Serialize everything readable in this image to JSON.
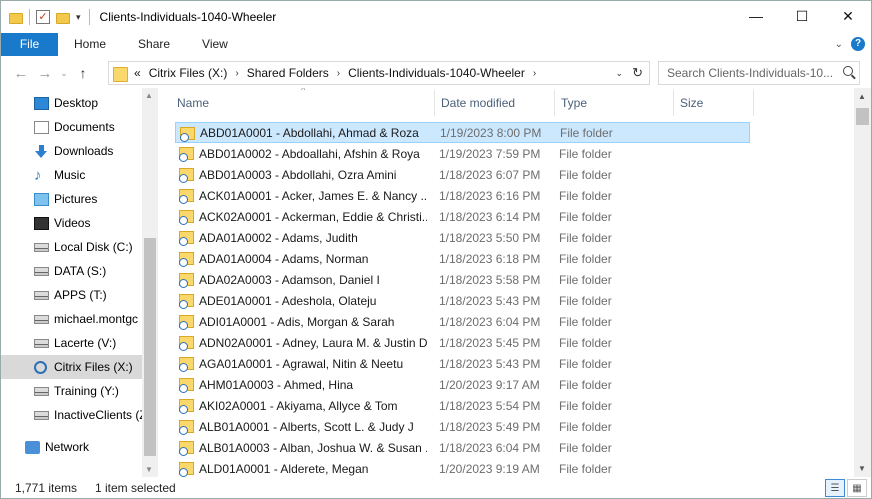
{
  "window": {
    "title": "Clients-Individuals-1040-Wheeler",
    "minimize": "—",
    "maximize": "☐",
    "close": "✕"
  },
  "ribbon": {
    "tabs": [
      "File",
      "Home",
      "Share",
      "View"
    ]
  },
  "address": {
    "overflow": "«",
    "crumbs": [
      "Citrix Files (X:)",
      "Shared Folders",
      "Clients-Individuals-1040-Wheeler"
    ]
  },
  "search": {
    "placeholder": "Search Clients-Individuals-10..."
  },
  "nav": {
    "items": [
      {
        "label": "Desktop",
        "icon": "desktop-icon"
      },
      {
        "label": "Documents",
        "icon": "documents-icon"
      },
      {
        "label": "Downloads",
        "icon": "downloads-icon"
      },
      {
        "label": "Music",
        "icon": "music-icon"
      },
      {
        "label": "Pictures",
        "icon": "pictures-icon"
      },
      {
        "label": "Videos",
        "icon": "videos-icon"
      },
      {
        "label": "Local Disk (C:)",
        "icon": "drive-icon"
      },
      {
        "label": "DATA (S:)",
        "icon": "network-drive-icon"
      },
      {
        "label": "APPS (T:)",
        "icon": "network-drive-icon"
      },
      {
        "label": "michael.montgc",
        "icon": "network-drive-icon"
      },
      {
        "label": "Lacerte (V:)",
        "icon": "network-drive-icon"
      },
      {
        "label": "Citrix Files (X:)",
        "icon": "citrix-icon",
        "selected": true
      },
      {
        "label": "Training (Y:)",
        "icon": "network-drive-icon"
      },
      {
        "label": "InactiveClients (Z",
        "icon": "network-drive-icon"
      },
      {
        "label": "Network",
        "icon": "network-icon"
      }
    ]
  },
  "columns": {
    "name": "Name",
    "date": "Date modified",
    "type": "Type",
    "size": "Size"
  },
  "files": [
    {
      "name": "ABD01A0001 - Abdollahi, Ahmad & Roza",
      "date": "1/19/2023 8:00 PM",
      "type": "File folder",
      "selected": true
    },
    {
      "name": "ABD01A0002 - Abdoallahi, Afshin & Roya",
      "date": "1/19/2023 7:59 PM",
      "type": "File folder"
    },
    {
      "name": "ABD01A0003 - Abdollahi, Ozra Amini",
      "date": "1/18/2023 6:07 PM",
      "type": "File folder"
    },
    {
      "name": "ACK01A0001 - Acker, James E. & Nancy ...",
      "date": "1/18/2023 6:16 PM",
      "type": "File folder"
    },
    {
      "name": "ACK02A0001 - Ackerman, Eddie & Christi...",
      "date": "1/18/2023 6:14 PM",
      "type": "File folder"
    },
    {
      "name": "ADA01A0002 - Adams, Judith",
      "date": "1/18/2023 5:50 PM",
      "type": "File folder"
    },
    {
      "name": "ADA01A0004 - Adams, Norman",
      "date": "1/18/2023 6:18 PM",
      "type": "File folder"
    },
    {
      "name": "ADA02A0003 - Adamson, Daniel I",
      "date": "1/18/2023 5:58 PM",
      "type": "File folder"
    },
    {
      "name": "ADE01A0001 - Adeshola, Olateju",
      "date": "1/18/2023 5:43 PM",
      "type": "File folder"
    },
    {
      "name": "ADI01A0001 - Adis, Morgan & Sarah",
      "date": "1/18/2023 6:04 PM",
      "type": "File folder"
    },
    {
      "name": "ADN02A0001 - Adney, Laura M. & Justin D",
      "date": "1/18/2023 5:45 PM",
      "type": "File folder"
    },
    {
      "name": "AGA01A0001 - Agrawal, Nitin & Neetu",
      "date": "1/18/2023 5:43 PM",
      "type": "File folder"
    },
    {
      "name": "AHM01A0003 - Ahmed, Hina",
      "date": "1/20/2023 9:17 AM",
      "type": "File folder"
    },
    {
      "name": "AKI02A0001 - Akiyama, Allyce & Tom",
      "date": "1/18/2023 5:54 PM",
      "type": "File folder"
    },
    {
      "name": "ALB01A0001 - Alberts, Scott L. & Judy J",
      "date": "1/18/2023 5:49 PM",
      "type": "File folder"
    },
    {
      "name": "ALB01A0003 - Alban, Joshua W. & Susan ...",
      "date": "1/18/2023 6:04 PM",
      "type": "File folder"
    },
    {
      "name": "ALD01A0001 - Alderete, Megan",
      "date": "1/20/2023 9:19 AM",
      "type": "File folder"
    }
  ],
  "status": {
    "count": "1,771 items",
    "selection": "1 item selected"
  }
}
